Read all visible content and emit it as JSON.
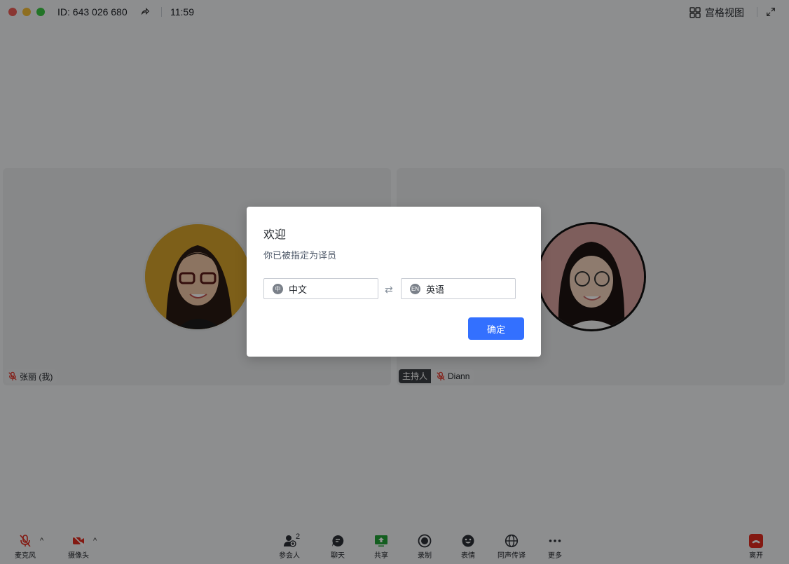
{
  "titlebar": {
    "meeting_id": "ID: 643 026 680",
    "timer": "11:59",
    "grid_view_label": "宫格视图"
  },
  "participants": [
    {
      "name": "张丽 (我)",
      "muted": true
    },
    {
      "role": "主持人",
      "name": "Diann",
      "muted": true
    }
  ],
  "toolbar": {
    "mic": "麦克风",
    "camera": "摄像头",
    "participants": "参会人",
    "participants_count": "2",
    "chat": "聊天",
    "share": "共享",
    "record": "录制",
    "reactions": "表情",
    "interpretation": "同声传译",
    "more": "更多",
    "leave": "离开"
  },
  "dialog": {
    "title": "欢迎",
    "subtitle": "你已被指定为译员",
    "from_lang_icon": "中",
    "from_lang": "中文",
    "to_lang_icon": "EN",
    "to_lang": "英语",
    "confirm": "确定"
  },
  "colors": {
    "accent": "#3370ff",
    "leave": "#e22c1f",
    "share": "#21a336",
    "muted": "#e22c1f"
  }
}
